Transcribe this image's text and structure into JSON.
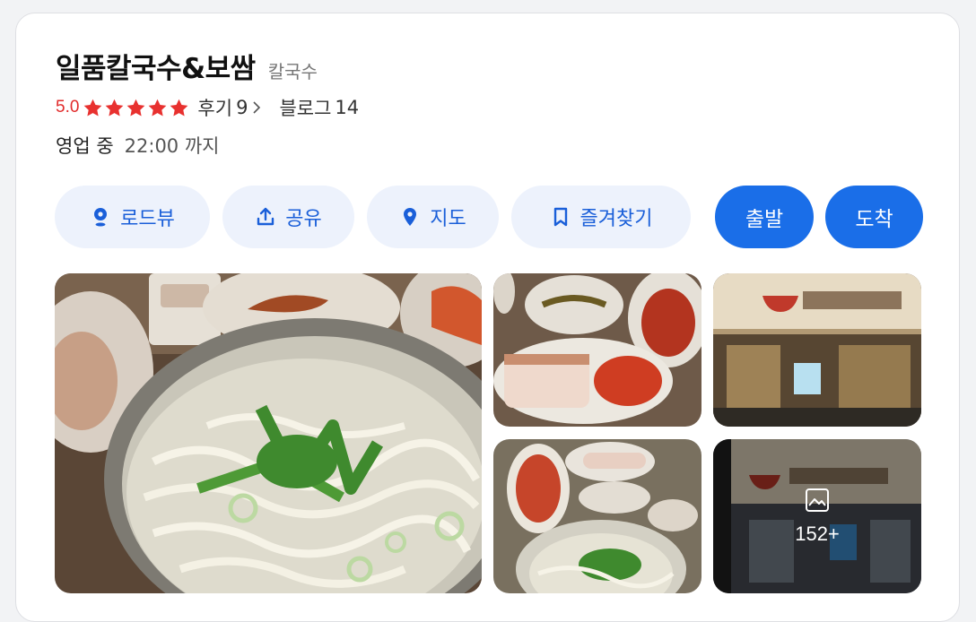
{
  "place": {
    "name": "일품칼국수&보쌈",
    "category": "칼국수"
  },
  "rating": {
    "score": "5.0",
    "stars": 5,
    "reviews_label": "후기",
    "reviews_count": "9",
    "blog_label": "블로그",
    "blog_count": "14"
  },
  "hours": {
    "status": "영업 중",
    "close_text": "22:00 까지"
  },
  "actions": {
    "roadview": "로드뷰",
    "share": "공유",
    "map": "지도",
    "bookmark": "즐겨찾기",
    "depart": "출발",
    "arrive": "도착"
  },
  "photos": {
    "more_count": "152+"
  },
  "colors": {
    "accent": "#1a6ee8",
    "pill_bg": "#edf2fc",
    "pill_text": "#1a5fd9",
    "star": "#e8312f"
  }
}
